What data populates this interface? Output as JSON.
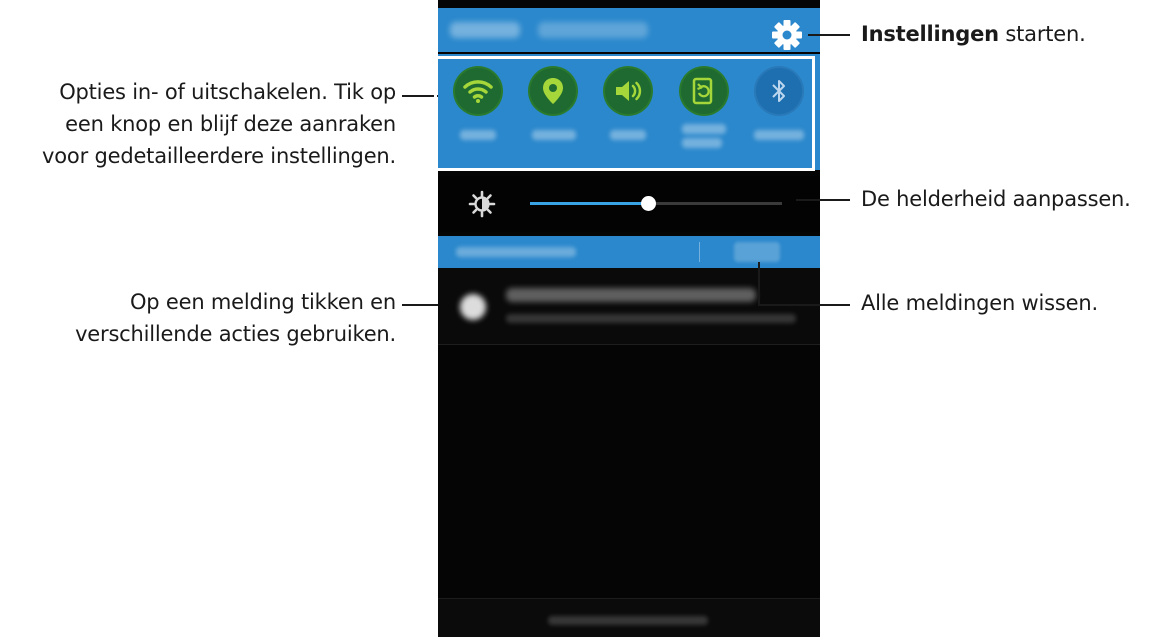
{
  "annotations": {
    "settings": {
      "bold": "Instellingen",
      "rest": " starten."
    },
    "quick_settings": {
      "line1": "Opties in- of uitschakelen. Tik op",
      "line2": "een knop en blijf deze aanraken",
      "line3": "voor gedetailleerdere instellingen."
    },
    "brightness": "De helderheid aanpassen.",
    "notification": {
      "line1": "Op een melding tikken en",
      "line2": "verschillende acties gebruiken."
    },
    "clear": "Alle meldingen wissen."
  },
  "phone": {
    "quick_settings": [
      {
        "icon": "wifi-icon",
        "state": "on"
      },
      {
        "icon": "location-icon",
        "state": "on"
      },
      {
        "icon": "sound-icon",
        "state": "on"
      },
      {
        "icon": "screen-rotation-icon",
        "state": "on"
      },
      {
        "icon": "bluetooth-icon",
        "state": "off"
      }
    ],
    "brightness_level": 0.47,
    "colors": {
      "panel_blue": "#2b88cc",
      "toggle_on": "#2a7a2e",
      "toggle_icon_on": "#a5d63a",
      "slider_fill": "#38a4e6"
    }
  }
}
